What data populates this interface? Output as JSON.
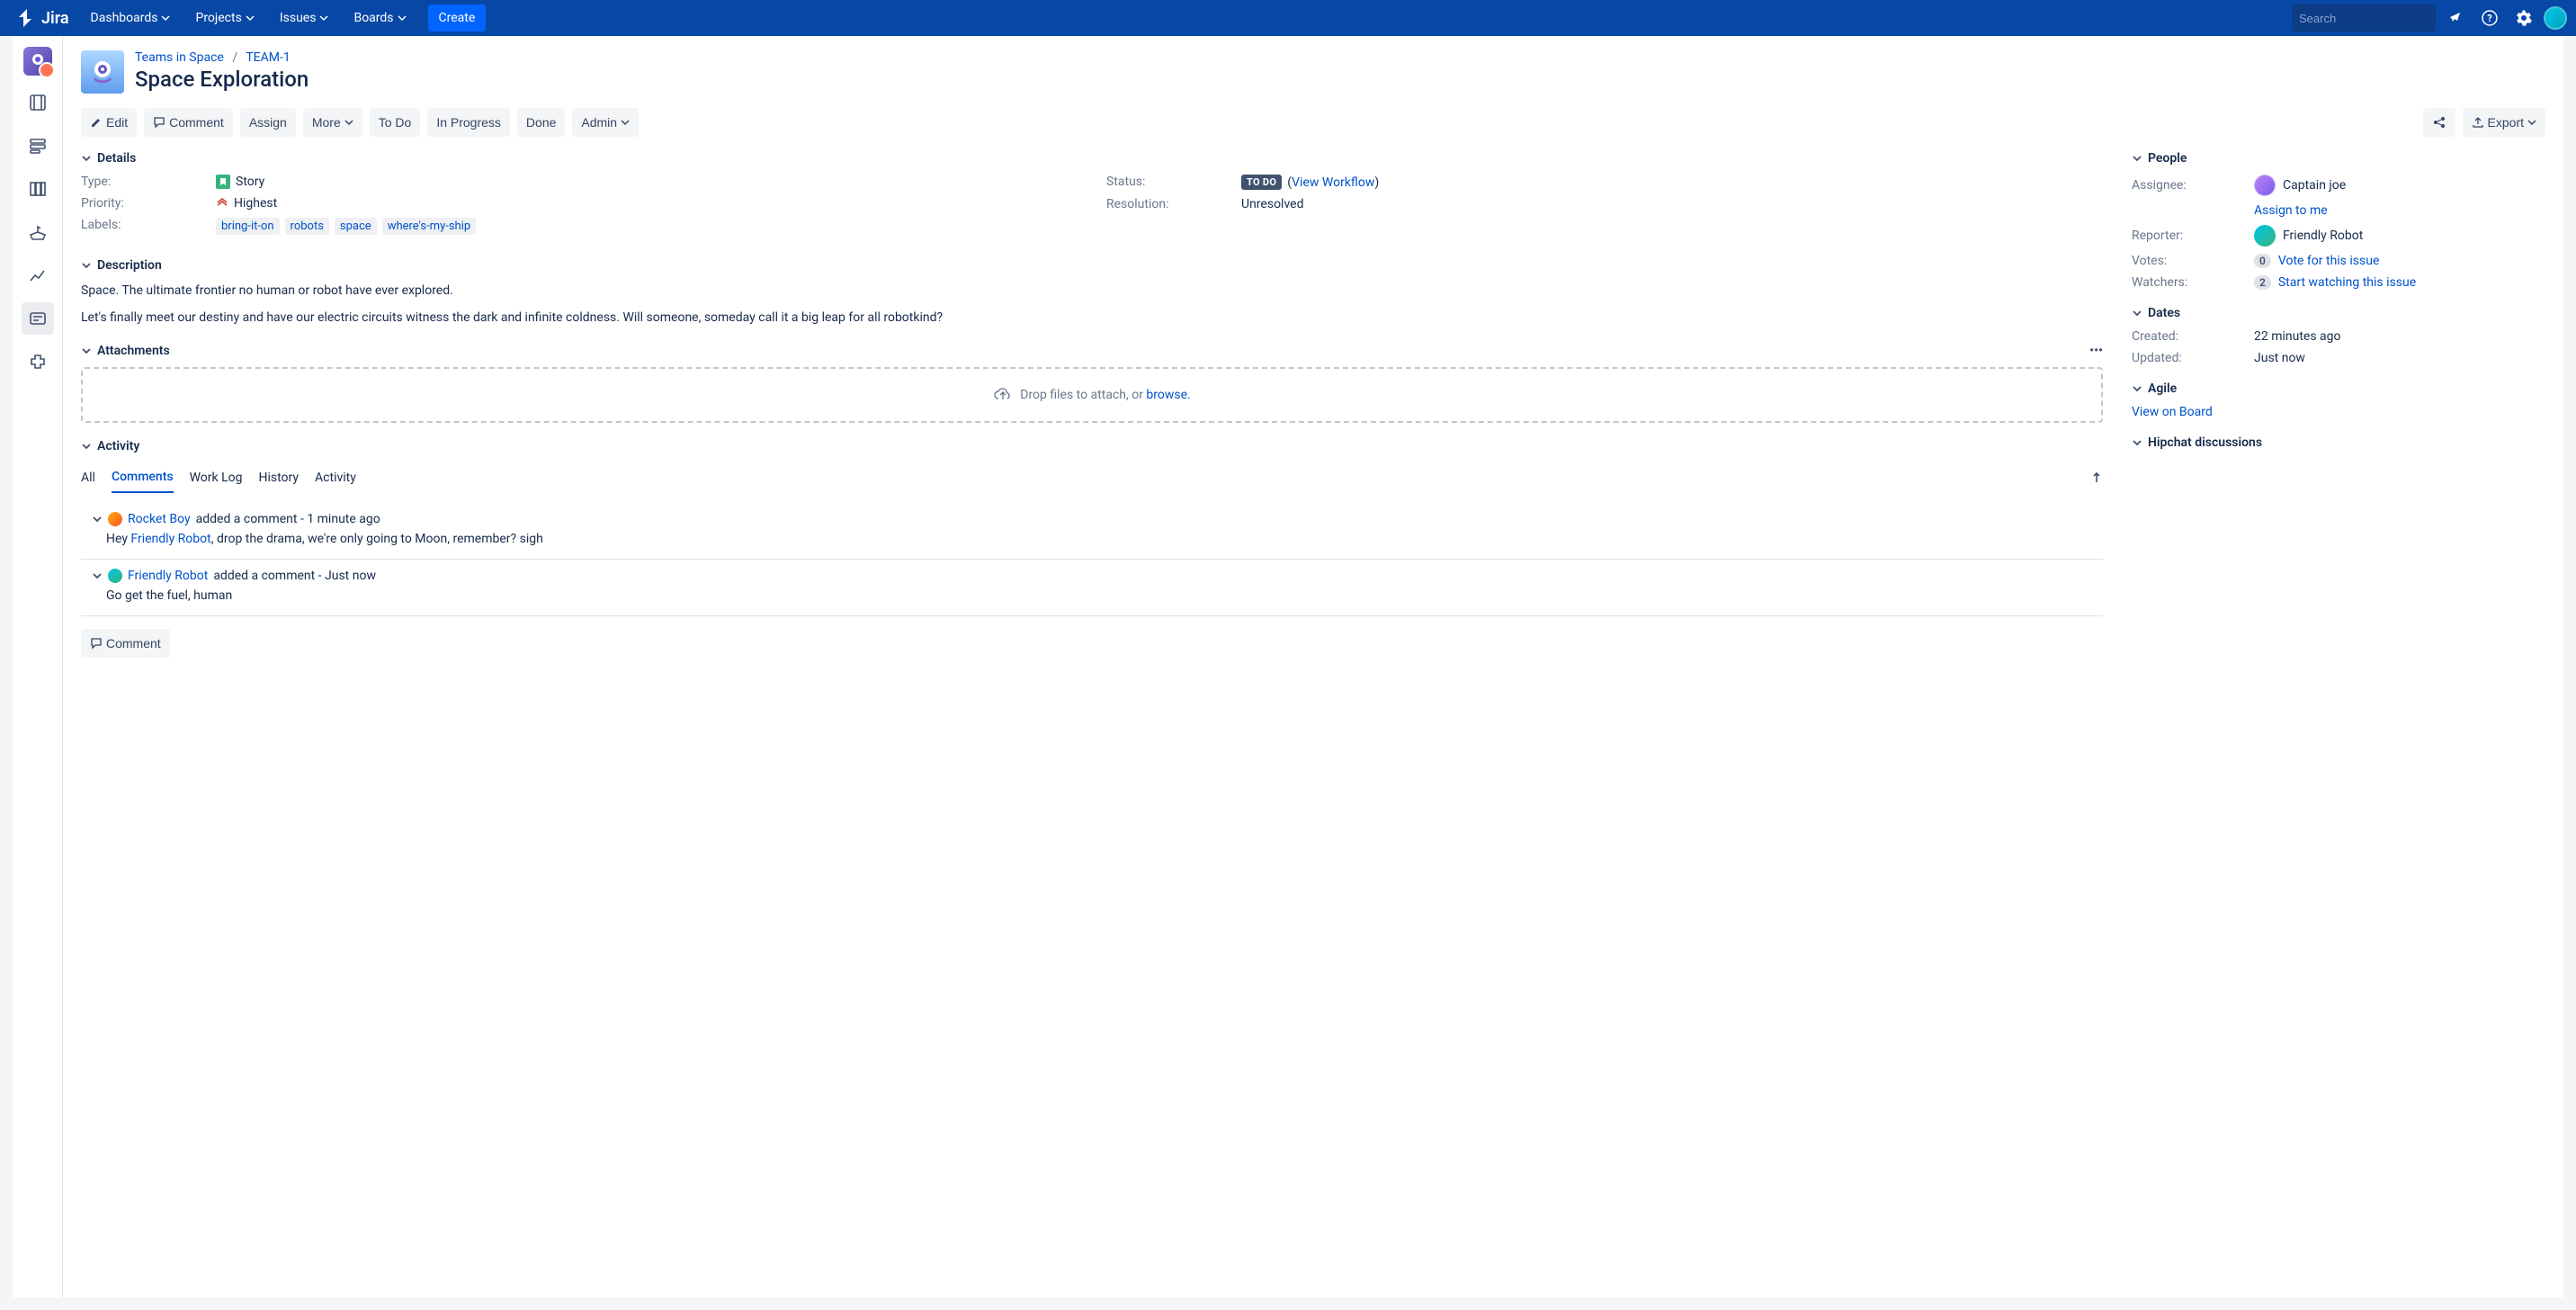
{
  "nav": {
    "logo_text": "Jira",
    "items": [
      "Dashboards",
      "Projects",
      "Issues",
      "Boards"
    ],
    "create": "Create",
    "search_placeholder": "Search"
  },
  "breadcrumb": {
    "project": "Teams in Space",
    "issue_key": "TEAM-1"
  },
  "issue_title": "Space Exploration",
  "toolbar": {
    "edit": "Edit",
    "comment": "Comment",
    "assign": "Assign",
    "more": "More",
    "todo": "To Do",
    "inprogress": "In Progress",
    "done": "Done",
    "admin": "Admin",
    "export": "Export"
  },
  "sections": {
    "details": "Details",
    "description": "Description",
    "attachments": "Attachments",
    "activity": "Activity",
    "people": "People",
    "dates": "Dates",
    "agile": "Agile",
    "hipchat": "Hipchat discussions"
  },
  "details": {
    "type_label": "Type:",
    "type_value": "Story",
    "priority_label": "Priority:",
    "priority_value": "Highest",
    "labels_label": "Labels:",
    "labels": [
      "bring-it-on",
      "robots",
      "space",
      "where's-my-ship"
    ],
    "status_label": "Status:",
    "status_lozenge": "TO DO",
    "view_workflow": "View Workflow",
    "resolution_label": "Resolution:",
    "resolution_value": "Unresolved"
  },
  "description": {
    "p1": "Space. The ultimate frontier no human or robot have ever explored.",
    "p2": "Let's finally meet our destiny and have our electric circuits witness the dark and infinite coldness. Will someone, someday call it a big leap for all robotkind?"
  },
  "attachments": {
    "drop_prefix": "Drop files to attach, or ",
    "browse": "browse."
  },
  "activity": {
    "tabs": {
      "all": "All",
      "comments": "Comments",
      "worklog": "Work Log",
      "history": "History",
      "activity": "Activity"
    },
    "comments": [
      {
        "author": "Rocket Boy",
        "meta": " added a comment - 1 minute ago",
        "body_pre": "Hey ",
        "body_link": "Friendly Robot",
        "body_post": ", drop the drama, we're only going to Moon, remember? sigh",
        "avatar_class": "cav-rocket"
      },
      {
        "author": "Friendly Robot",
        "meta": " added a comment - Just now",
        "body_pre": "Go get the fuel, human",
        "body_link": "",
        "body_post": "",
        "avatar_class": "cav-robot"
      }
    ],
    "comment_btn": "Comment"
  },
  "people": {
    "assignee_label": "Assignee:",
    "assignee_value": "Captain joe",
    "assign_to_me": "Assign to me",
    "reporter_label": "Reporter:",
    "reporter_value": "Friendly Robot",
    "votes_label": "Votes:",
    "votes_count": "0",
    "vote_link": "Vote for this issue",
    "watchers_label": "Watchers:",
    "watchers_count": "2",
    "watch_link": "Start watching this issue"
  },
  "dates": {
    "created_label": "Created:",
    "created_value": "22 minutes ago",
    "updated_label": "Updated:",
    "updated_value": "Just now"
  },
  "agile": {
    "view_on_board": "View on Board"
  }
}
